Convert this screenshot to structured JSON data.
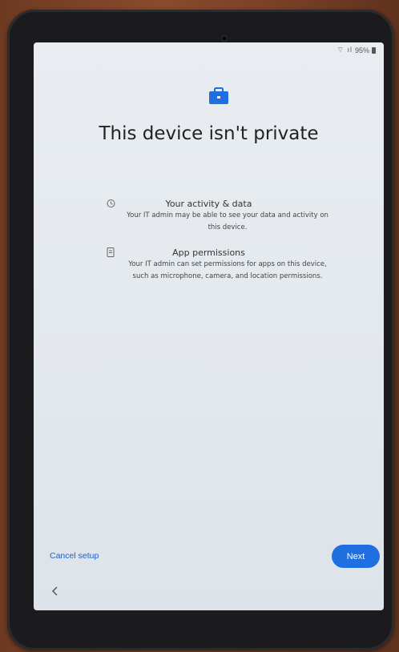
{
  "status": {
    "battery": "95%"
  },
  "title": "This device isn't private",
  "items": [
    {
      "icon": "history-icon",
      "title": "Your activity & data",
      "desc": "Your IT admin may be able to see your data and activity on this device."
    },
    {
      "icon": "app-permission-icon",
      "title": "App permissions",
      "desc": "Your IT admin can set permissions for apps on this device, such as microphone, camera, and location permissions."
    }
  ],
  "footer": {
    "cancel_label": "Cancel setup",
    "next_label": "Next"
  },
  "colors": {
    "accent": "#1f6fe0",
    "link": "#1f5fc6"
  }
}
